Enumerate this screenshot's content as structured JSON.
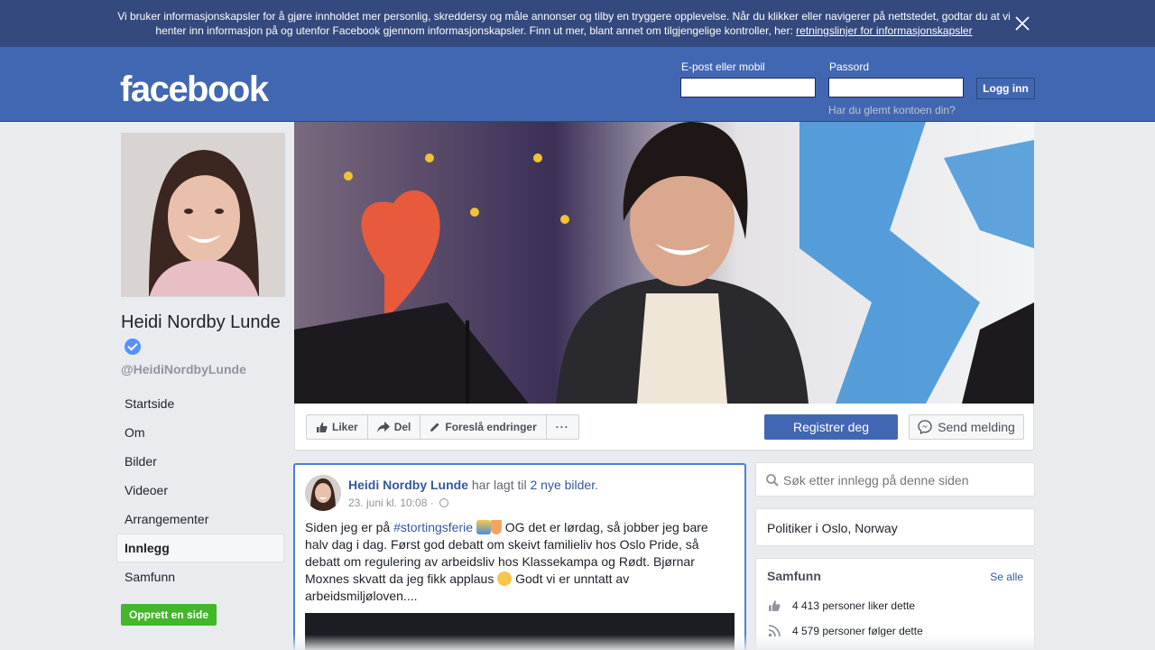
{
  "cookie_banner": {
    "text": "Vi bruker informasjonskapsler for å gjøre innholdet mer personlig, skreddersy og måle annonser og tilby en tryggere opplevelse. Når du klikker eller navigerer på nettstedet, godtar du at vi henter inn informasjon på og utenfor Facebook gjennom informasjonskapsler. Finn ut mer, blant annet om tilgjengelige kontroller, her: ",
    "link": "retningslinjer for informasjonskapsler"
  },
  "header": {
    "logo": "facebook",
    "email_label": "E-post eller mobil",
    "email_value": "",
    "password_label": "Passord",
    "password_value": "",
    "login_button": "Logg inn",
    "forgot_link": "Har du glemt kontoen din?"
  },
  "profile": {
    "name": "Heidi Nordby Lunde",
    "handle": "@HeidiNordbyLunde"
  },
  "nav": {
    "items": [
      "Startside",
      "Om",
      "Bilder",
      "Videoer",
      "Arrangementer",
      "Innlegg",
      "Samfunn"
    ],
    "active": "Innlegg",
    "create_page": "Opprett en side"
  },
  "actions": {
    "like": "Liker",
    "share": "Del",
    "suggest": "Foreslå endringer",
    "more": "···",
    "register": "Registrer deg",
    "message": "Send melding"
  },
  "post": {
    "author": "Heidi Nordby Lunde",
    "action_text": " har lagt til ",
    "photos_link": "2 nye bilder",
    "period": ".",
    "timestamp": "23. juni kl. 10:08 · ",
    "text_prefix": "Siden jeg er på ",
    "hashtag": "#stortingsferie",
    "text_part2": " OG det er lørdag, så jobber jeg bare halv dag i dag. Først god debatt om skeivt familieliv hos Oslo Pride, så debatt om regulering av arbeidsliv hos Klassekampa og Rødt. Bjørnar Moxnes skvatt da jeg fikk applaus ",
    "text_part3": " Godt vi er unntatt av arbeidsmiljøloven...."
  },
  "sidebar": {
    "search_placeholder": "Søk etter innlegg på denne siden",
    "about": "Politiker i Oslo, Norway",
    "community_title": "Samfunn",
    "see_all": "Se alle",
    "likes": "4 413 personer liker dette",
    "follows": "4 579 personer følger dette"
  },
  "colors": {
    "brand": "#4267b2",
    "banner": "#34497e",
    "link": "#365899",
    "green": "#42b72a"
  }
}
